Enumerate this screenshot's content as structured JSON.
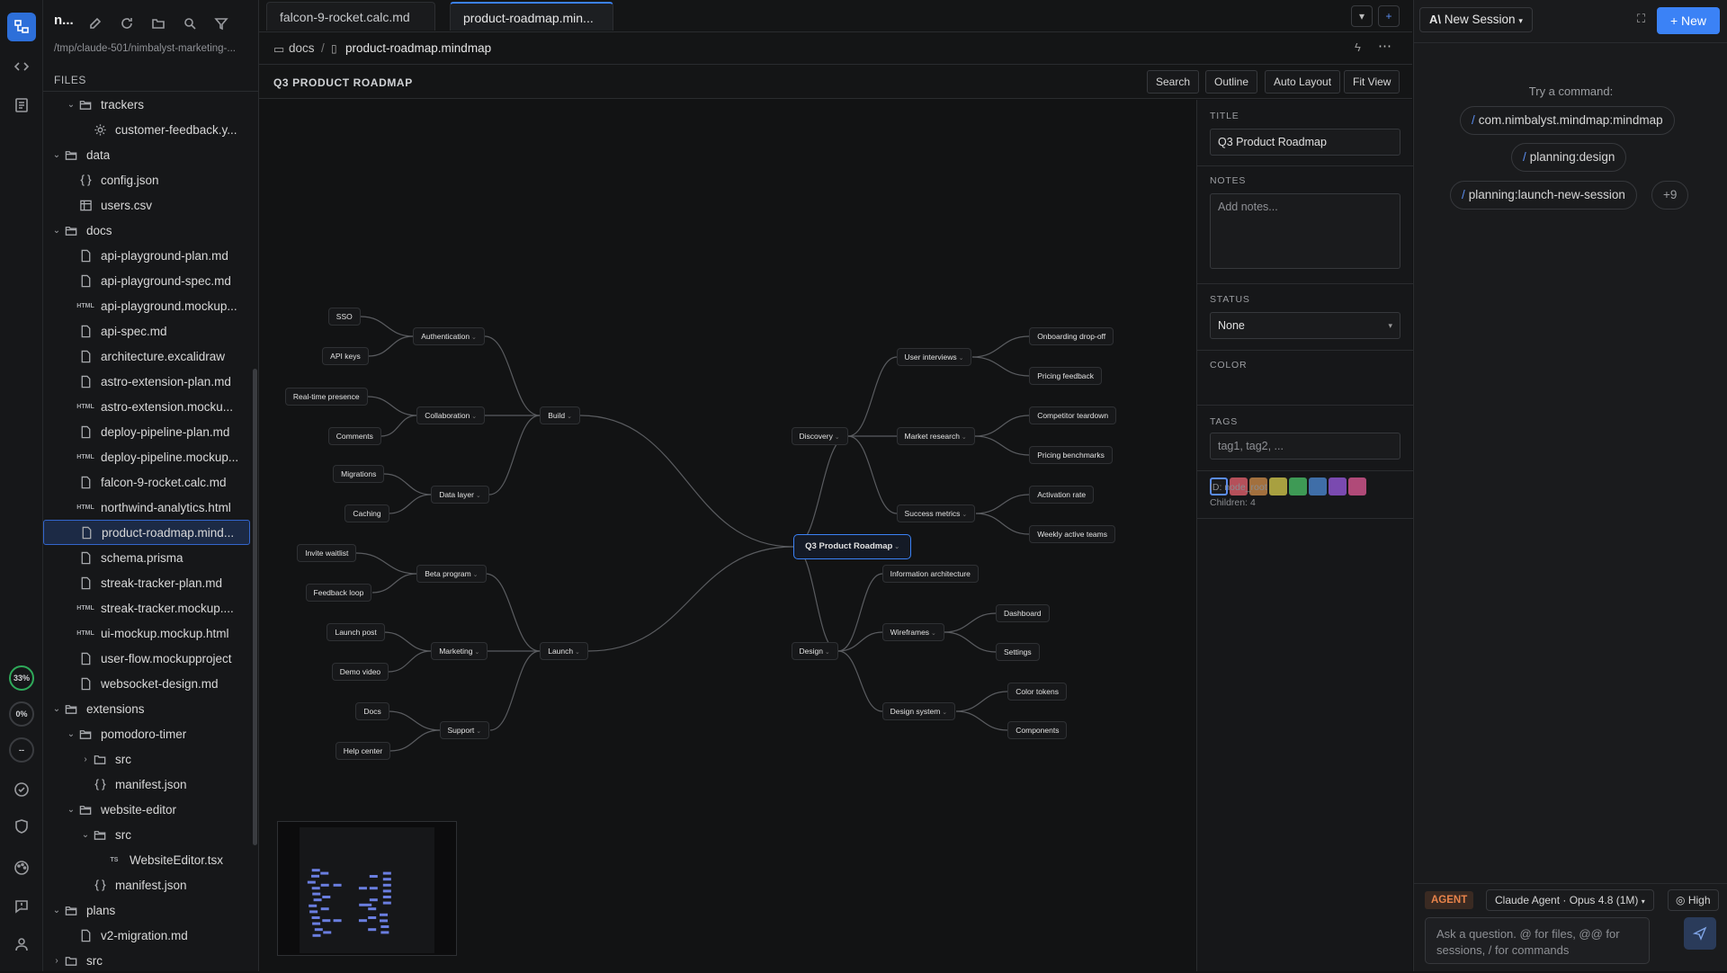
{
  "sidebar": {
    "title": "n...",
    "path": "/tmp/claude-501/nimbalyst-marketing-...",
    "files_label": "FILES",
    "tree": [
      {
        "label": "trackers",
        "icon": "folder-open-icon",
        "chev": "v",
        "depth": 1
      },
      {
        "label": "customer-feedback.y...",
        "icon": "gear-icon",
        "chev": "",
        "depth": 2
      },
      {
        "label": "data",
        "icon": "folder-open-icon",
        "chev": "v",
        "depth": 0
      },
      {
        "label": "config.json",
        "icon": "json-icon",
        "chev": "",
        "depth": 1
      },
      {
        "label": "users.csv",
        "icon": "table-icon",
        "chev": "",
        "depth": 1
      },
      {
        "label": "docs",
        "icon": "folder-open-icon",
        "chev": "v",
        "depth": 0
      },
      {
        "label": "api-playground-plan.md",
        "icon": "file-icon",
        "chev": "",
        "depth": 1
      },
      {
        "label": "api-playground-spec.md",
        "icon": "file-icon",
        "chev": "",
        "depth": 1
      },
      {
        "label": "api-playground.mockup...",
        "icon": "html-icon",
        "chev": "",
        "depth": 1
      },
      {
        "label": "api-spec.md",
        "icon": "file-icon",
        "chev": "",
        "depth": 1
      },
      {
        "label": "architecture.excalidraw",
        "icon": "file-icon",
        "chev": "",
        "depth": 1
      },
      {
        "label": "astro-extension-plan.md",
        "icon": "file-icon",
        "chev": "",
        "depth": 1
      },
      {
        "label": "astro-extension.mocku...",
        "icon": "html-icon",
        "chev": "",
        "depth": 1
      },
      {
        "label": "deploy-pipeline-plan.md",
        "icon": "file-icon",
        "chev": "",
        "depth": 1
      },
      {
        "label": "deploy-pipeline.mockup...",
        "icon": "html-icon",
        "chev": "",
        "depth": 1
      },
      {
        "label": "falcon-9-rocket.calc.md",
        "icon": "file-icon",
        "chev": "",
        "depth": 1
      },
      {
        "label": "northwind-analytics.html",
        "icon": "html-icon",
        "chev": "",
        "depth": 1
      },
      {
        "label": "product-roadmap.mind...",
        "icon": "file-icon",
        "chev": "",
        "depth": 1,
        "selected": true
      },
      {
        "label": "schema.prisma",
        "icon": "file-icon",
        "chev": "",
        "depth": 1
      },
      {
        "label": "streak-tracker-plan.md",
        "icon": "file-icon",
        "chev": "",
        "depth": 1
      },
      {
        "label": "streak-tracker.mockup....",
        "icon": "html-icon",
        "chev": "",
        "depth": 1
      },
      {
        "label": "ui-mockup.mockup.html",
        "icon": "html-icon",
        "chev": "",
        "depth": 1
      },
      {
        "label": "user-flow.mockupproject",
        "icon": "file-icon",
        "chev": "",
        "depth": 1
      },
      {
        "label": "websocket-design.md",
        "icon": "file-icon",
        "chev": "",
        "depth": 1
      },
      {
        "label": "extensions",
        "icon": "folder-open-icon",
        "chev": "v",
        "depth": 0
      },
      {
        "label": "pomodoro-timer",
        "icon": "folder-open-icon",
        "chev": "v",
        "depth": 1
      },
      {
        "label": "src",
        "icon": "folder-icon",
        "chev": ">",
        "depth": 2
      },
      {
        "label": "manifest.json",
        "icon": "json-icon",
        "chev": "",
        "depth": 2
      },
      {
        "label": "website-editor",
        "icon": "folder-open-icon",
        "chev": "v",
        "depth": 1
      },
      {
        "label": "src",
        "icon": "folder-open-icon",
        "chev": "v",
        "depth": 2
      },
      {
        "label": "WebsiteEditor.tsx",
        "icon": "ts-icon",
        "chev": "",
        "depth": 3
      },
      {
        "label": "manifest.json",
        "icon": "json-icon",
        "chev": "",
        "depth": 2
      },
      {
        "label": "plans",
        "icon": "folder-open-icon",
        "chev": "v",
        "depth": 0
      },
      {
        "label": "v2-migration.md",
        "icon": "file-icon",
        "chev": "",
        "depth": 1
      },
      {
        "label": "src",
        "icon": "folder-icon",
        "chev": ">",
        "depth": 0
      }
    ]
  },
  "activity": {
    "progress1": "33%",
    "progress2": "0%",
    "progress3": "--"
  },
  "tabs": [
    "falcon-9-rocket.calc.md",
    "product-roadmap.min..."
  ],
  "breadcrumb": {
    "folder": "docs",
    "sep": "/",
    "file": "product-roadmap.mindmap"
  },
  "toolbar": {
    "title": "Q3 PRODUCT ROADMAP",
    "search": "Search",
    "outline": "Outline",
    "auto_layout": "Auto Layout",
    "fit_view": "Fit View"
  },
  "mindmap": {
    "root": "Q3 Product Roadmap",
    "nodes": {
      "build": "Build",
      "launch": "Launch",
      "discovery": "Discovery",
      "design": "Design",
      "auth": "Authentication",
      "collab": "Collaboration",
      "datalayer": "Data layer",
      "sso": "SSO",
      "apikeys": "API keys",
      "realtime": "Real-time presence",
      "comments": "Comments",
      "migrations": "Migrations",
      "caching": "Caching",
      "beta": "Beta program",
      "marketing": "Marketing",
      "support": "Support",
      "invite": "Invite waitlist",
      "feedback": "Feedback loop",
      "launchpost": "Launch post",
      "demo": "Demo video",
      "docs": "Docs",
      "help": "Help center",
      "interviews": "User interviews",
      "market": "Market research",
      "metrics": "Success metrics",
      "onboarding": "Onboarding drop-off",
      "pricingfb": "Pricing feedback",
      "competitor": "Competitor teardown",
      "benchmarks": "Pricing benchmarks",
      "activation": "Activation rate",
      "wat": "Weekly active teams",
      "infoarch": "Information architecture",
      "wireframes": "Wireframes",
      "designsys": "Design system",
      "dashboard": "Dashboard",
      "settings": "Settings",
      "colortokens": "Color tokens",
      "components": "Components"
    }
  },
  "props": {
    "title_label": "TITLE",
    "title_value": "Q3 Product Roadmap",
    "notes_label": "NOTES",
    "notes_placeholder": "Add notes...",
    "status_label": "STATUS",
    "status_value": "None",
    "color_label": "COLOR",
    "colors": [
      "#1a1b1d",
      "#b5505a",
      "#a2703e",
      "#a8a040",
      "#3e9a55",
      "#3f6ea8",
      "#7a4ab0",
      "#b04a78"
    ],
    "tags_label": "TAGS",
    "tags_placeholder": "tag1, tag2, ...",
    "id_text": "ID: node_root",
    "children_text": "Children: 4"
  },
  "agent": {
    "new_session": "New Session",
    "new_button": "New",
    "try_label": "Try a command:",
    "commands": [
      "com.nimbalyst.mindmap:mindmap",
      "planning:design",
      "planning:launch-new-session"
    ],
    "more": "+9",
    "agent_badge": "AGENT",
    "model": "Claude Agent · Opus 4.8 (1M)",
    "effort": "High",
    "input_placeholder": "Ask a question. @ for files, @@ for sessions, / for commands"
  }
}
